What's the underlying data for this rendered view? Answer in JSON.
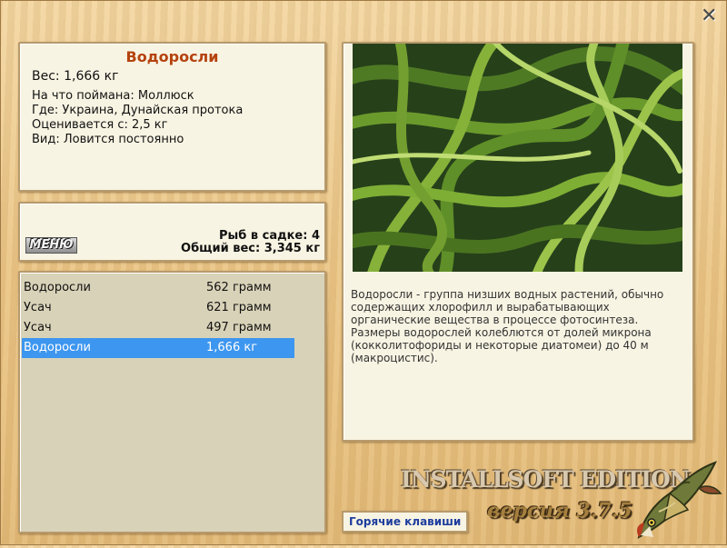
{
  "info": {
    "title": "Водоросли",
    "weight": "Вес: 1,666 кг",
    "lines": [
      "На что поймана: Моллюск",
      "Где: Украина, Дунайская протока",
      "Оценивается с: 2,5 кг",
      "Вид: Ловится постоянно"
    ]
  },
  "menu_label": "МЕНЮ",
  "cage": {
    "fish_count": "Рыб в садке: 4",
    "total_weight": "Общий вес: 3,345 кг"
  },
  "catch_list": [
    {
      "name": "Водоросли",
      "weight": "562 грамм",
      "selected": false
    },
    {
      "name": "Усач",
      "weight": "621 грамм",
      "selected": false
    },
    {
      "name": "Усач",
      "weight": "497 грамм",
      "selected": false
    },
    {
      "name": "Водоросли",
      "weight": "1,666 кг",
      "selected": true
    }
  ],
  "description": "Водоросли - группа низших водных растений, обычно содержащих хлорофилл и вырабатывающих органические вещества в процессе фотосинтеза. Размеры водорослей колеблются от долей микрона (кокколитофориды и некоторые диатомеи) до 40 м (макроцистис).",
  "brand": "INSTALLSOFT EDITION",
  "version": "версия 3.7.5",
  "hotkeys_label": "Горячие клавиши",
  "icons": {
    "close": "close-icon",
    "logo": "pike-fish-icon",
    "photo": "seaweed-photo"
  },
  "colors": {
    "title": "#b5420e",
    "selected_row": "#3d96ef",
    "link": "#1d3d9e"
  }
}
